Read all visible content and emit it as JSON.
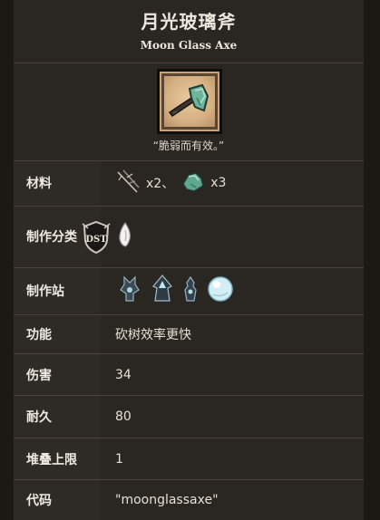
{
  "item": {
    "name_zh": "月光玻璃斧",
    "name_en": "Moon Glass Axe",
    "quote": "“脆弱而有效。”",
    "portrait_icon": "moon-glass-axe-icon"
  },
  "rows": {
    "materials": {
      "label": "材料",
      "items": [
        {
          "icon": "twigs-icon",
          "qty": "x2、"
        },
        {
          "icon": "moon-glass-icon",
          "qty": "x3"
        }
      ]
    },
    "category": {
      "label": "制作分类",
      "badge_icon": "dst-badge-icon",
      "icon": "celestial-tab-icon"
    },
    "station": {
      "label": "制作站",
      "icons": [
        "celestial-altar-icon",
        "celestial-sanctum-icon",
        "celestial-tribute-icon",
        "celestial-orb-icon"
      ]
    },
    "function": {
      "label": "功能",
      "value": "砍树效率更快"
    },
    "damage": {
      "label": "伤害",
      "value": "34"
    },
    "durability": {
      "label": "耐久",
      "value": "80"
    },
    "stack": {
      "label": "堆叠上限",
      "value": "1"
    },
    "code": {
      "label": "代码",
      "value": "\"moonglassaxe\""
    }
  },
  "colors": {
    "panel": "#2a2723",
    "label_bg": "#2e2b27",
    "divider": "#4a443c",
    "glass": "#5fa890"
  }
}
